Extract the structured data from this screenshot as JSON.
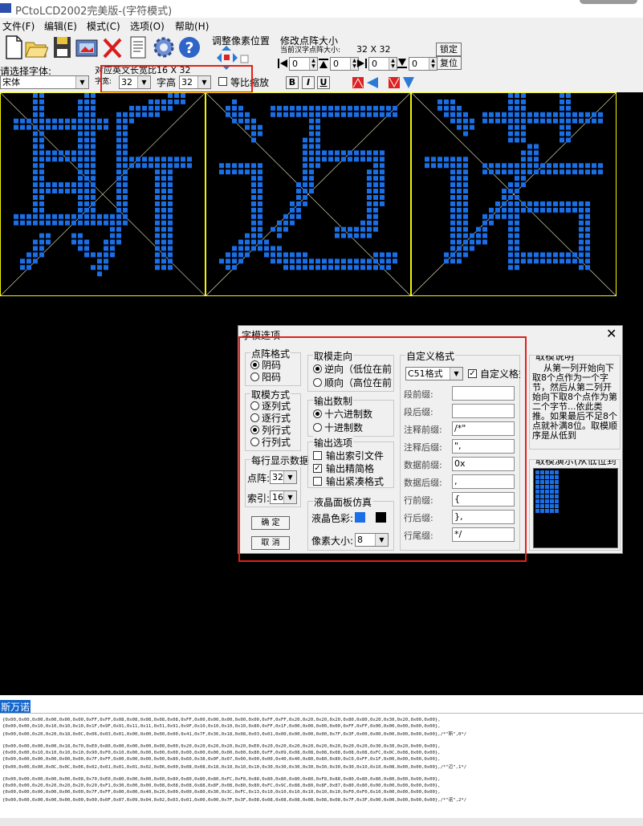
{
  "window": {
    "title": "PCtoLCD2002完美版-(字符模式)"
  },
  "menu": [
    "文件(F)",
    "编辑(E)",
    "模式(C)",
    "选项(O)",
    "帮助(H)"
  ],
  "toolbar": {
    "icons": [
      "new-file-icon",
      "open-folder-icon",
      "save-disk-icon",
      "load-image-icon",
      "delete-x-icon",
      "document-icon",
      "gear-icon",
      "help-question-icon"
    ],
    "adjust_pixels_label": "调整像素位置",
    "resize_label": "修改点阵大小",
    "current_size_label": "当前汉字点阵大小:",
    "current_size_value": "32 X 32",
    "lock_button": "锁定",
    "restore_button": "复位",
    "spinners": [
      "0",
      "0",
      "0",
      "0"
    ],
    "font_label": "请选择字体:",
    "font_value": "宋体",
    "ratio_label": "对应英文长宽比16 X 32",
    "width_label": "字宽:",
    "width_value": "32",
    "height_label": "字高",
    "height_value": "32",
    "proportional_label": "等比缩放",
    "bold": "B",
    "italic": "I",
    "underline": "U"
  },
  "canvas": {
    "characters": [
      "斯",
      "迈",
      "诺"
    ],
    "dot_color": "#1b6fe6",
    "grid_color": "#f2f20a",
    "bg": "#000000"
  },
  "dialog": {
    "title": "字模选项",
    "dot_format": {
      "title": "点阵格式",
      "options": [
        "阴码",
        "阳码"
      ],
      "selected": 0
    },
    "scan_mode": {
      "title": "取模方式",
      "options": [
        "逐列式",
        "逐行式",
        "列行式",
        "行列式"
      ],
      "selected": 2
    },
    "per_line": {
      "title": "每行显示数据",
      "dot_label": "点阵:",
      "dot_value": "32",
      "index_label": "索引:",
      "index_value": "16"
    },
    "direction": {
      "title": "取模走向",
      "options": [
        "逆向（低位在前",
        "顺向（高位在前"
      ],
      "selected": 0
    },
    "radix": {
      "title": "输出数制",
      "options": [
        "十六进制数",
        "十进制数"
      ],
      "selected": 0
    },
    "output_options": {
      "title": "输出选项",
      "options": [
        "输出索引文件",
        "输出精简格",
        "输出紧凑格式"
      ],
      "checked": [
        false,
        true,
        false
      ]
    },
    "lcd": {
      "title": "液晶面板仿真",
      "color_label": "液晶色彩:",
      "pixel_label": "像素大小:",
      "pixel_value": "8",
      "colors": [
        "#1b6fe6",
        "#000000"
      ]
    },
    "custom": {
      "title": "自定义格式",
      "format_value": "C51格式",
      "custom_check_label": "自定义格式",
      "custom_checked": true,
      "rows": [
        {
          "label": "段前缀:",
          "value": ""
        },
        {
          "label": "段后缀:",
          "value": ""
        },
        {
          "label": "注释前缀:",
          "value": "/*\""
        },
        {
          "label": "注释后缀:",
          "value": "\","
        },
        {
          "label": "数据前缀:",
          "value": "0x"
        },
        {
          "label": "数据后缀:",
          "value": ","
        },
        {
          "label": "行前缀:",
          "value": "{"
        },
        {
          "label": "行后缀:",
          "value": "},"
        },
        {
          "label": "行尾缀:",
          "value": "*/"
        }
      ]
    },
    "explain": {
      "title": "取模说明",
      "text": "从第一列开始向下取8个点作为一个字节，然后从第二列开始向下取8个点作为第二个字节...依此类推。如果最后不足8个点就补满8位。取模顺序是从低到"
    },
    "demo": {
      "title": "取模演示(从低位到"
    },
    "ok_button": "确 定",
    "cancel_button": "取 消"
  },
  "output": {
    "chars": "斯万诺",
    "lines": [
      "{0x00,0x00,0x00,0x00,0x00,0x00,0xFF,0xFF,0x08,0x08,0x08,0x08,0x08,0xFF,0x00,0x00,0x00,0x00,0x00,0xFF,0xFF,0x20,0x20,0x20,0x20,0x80,0x80,0x20,0x30,0x20,0x00,0x00},",
      "{0x00,0x00,0x10,0x10,0x10,0x10,0x1F,0x9F,0x91,0x11,0x11,0x51,0x91,0x9F,0x10,0x10,0x10,0x10,0x80,0xFF,0x1F,0x00,0x00,0x00,0x00,0xFF,0xFF,0x00,0x00,0x00,0x00,0x00},",
      "{0x00,0x00,0x20,0x20,0x18,0x0C,0x06,0x03,0x01,0x00,0x00,0x00,0x00,0x41,0x7F,0x36,0x18,0x08,0x03,0x01,0x00,0x00,0x00,0x00,0x7F,0x3F,0x00,0x00,0x00,0x00,0x00,0x00},/*\"斯\",0*/",
      "{0x00,0x00,0x00,0x00,0x18,0x70,0xE0,0x80,0x00,0x00,0x00,0x00,0x00,0x20,0x20,0x20,0x20,0x20,0xE0,0x20,0x20,0x20,0x20,0x20,0x20,0x20,0x20,0x30,0x30,0x20,0x00,0x00},",
      "{0x00,0x00,0x10,0x10,0x10,0x10,0x90,0xF0,0x10,0x00,0x00,0x00,0x00,0x00,0x00,0x00,0x00,0x00,0x80,0xFF,0x09,0x08,0x08,0x08,0x08,0x08,0x08,0xFC,0x0C,0x08,0x00,0x00},",
      "{0x00,0x00,0x00,0x00,0x00,0x00,0x7F,0xFF,0x00,0x00,0x00,0x00,0x80,0x60,0x38,0x0F,0x07,0x00,0x00,0x00,0x40,0x40,0x80,0x80,0x80,0xC0,0xFF,0x1F,0x00,0x00,0x00,0x00},",
      "{0x00,0x00,0x00,0x0C,0x0C,0x06,0x02,0x01,0x01,0x01,0x02,0x06,0x00,0x08,0x08,0x18,0x10,0x10,0x10,0x30,0x30,0x30,0x30,0x30,0x30,0x30,0x10,0x10,0x08,0x00,0x00,0x00},/*\"迈\",1*/",
      "{0x00,0x00,0x00,0x00,0x00,0x08,0x70,0xE0,0x80,0x00,0x00,0x00,0x80,0x80,0x80,0x80,0xFC,0xF8,0x88,0x80,0x80,0x80,0x80,0xF8,0x88,0x80,0x80,0x80,0x80,0x00,0x00,0x00},",
      "{0x00,0x00,0x20,0x20,0x20,0x20,0x20,0xF1,0x30,0x00,0x00,0x08,0x08,0x08,0x88,0x8F,0x08,0x80,0x80,0xFC,0x9C,0x88,0x80,0x8F,0x87,0x80,0x80,0x00,0x00,0x00,0x00,0x00},",
      "{0x00,0x00,0x00,0x00,0x00,0x00,0x7F,0xFF,0x00,0x00,0x40,0x20,0x00,0x00,0x80,0x30,0x3C,0xFC,0x13,0x10,0x10,0x10,0x10,0x10,0x10,0xF0,0xF0,0x10,0x00,0x00,0x00,0x00},",
      "{0x00,0x00,0x00,0x00,0x00,0x00,0x00,0x0F,0x07,0x09,0x04,0x02,0x03,0x01,0x00,0x00,0x7F,0x3F,0x08,0x08,0x08,0x08,0x08,0x08,0x08,0x7F,0x3F,0x00,0x00,0x00,0x00,0x00},/*\"诺\",2*/"
    ]
  }
}
